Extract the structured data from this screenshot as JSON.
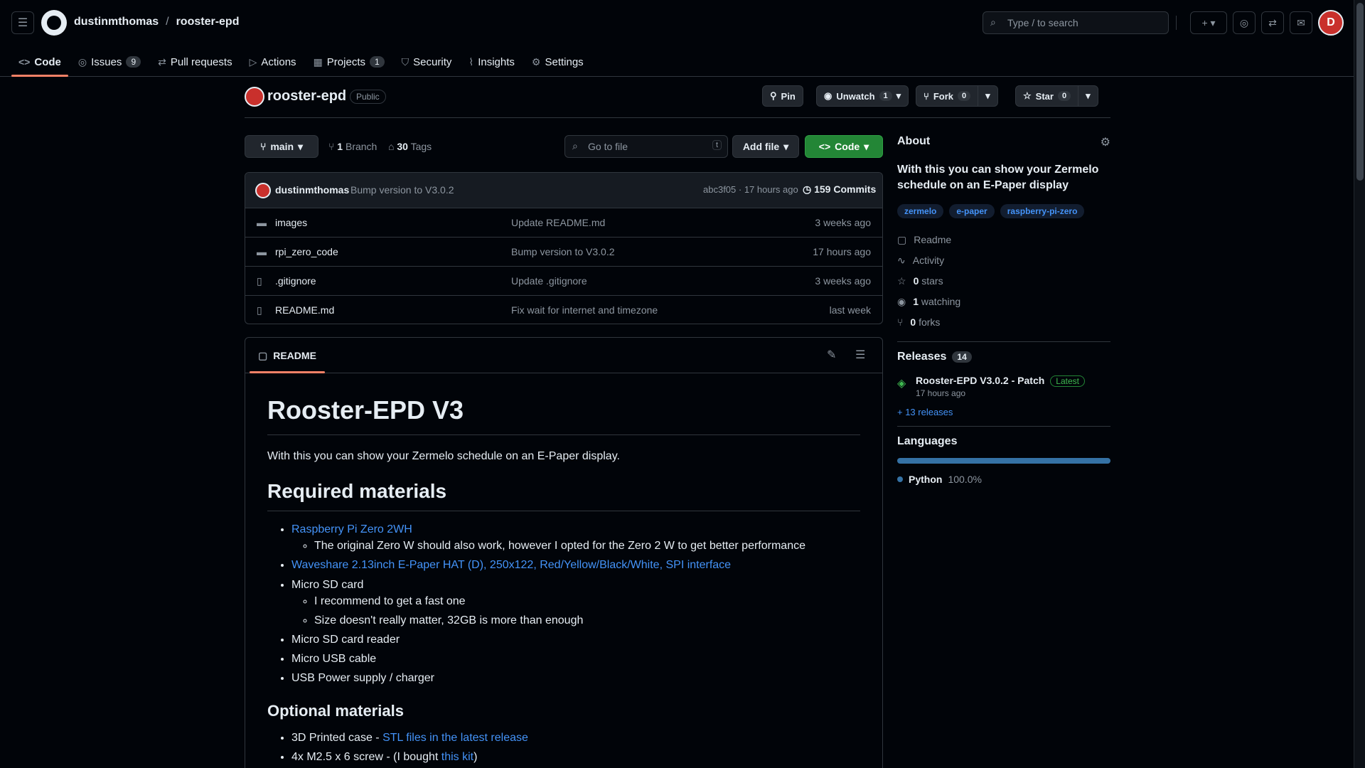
{
  "header": {
    "owner": "dustinmthomas",
    "separator": "/",
    "repo": "rooster-epd",
    "search_placeholder": "Type / to search",
    "avatar_initial": "D",
    "plus_label": "+"
  },
  "repo_nav": [
    {
      "label": "Code",
      "icon": "<>",
      "count": ""
    },
    {
      "label": "Issues",
      "icon": "◎",
      "count": "9"
    },
    {
      "label": "Pull requests",
      "icon": "⇄",
      "count": ""
    },
    {
      "label": "Actions",
      "icon": "▷",
      "count": ""
    },
    {
      "label": "Projects",
      "icon": "▦",
      "count": "1"
    },
    {
      "label": "Security",
      "icon": "⛉",
      "count": ""
    },
    {
      "label": "Insights",
      "icon": "⌇",
      "count": ""
    },
    {
      "label": "Settings",
      "icon": "⚙",
      "count": ""
    }
  ],
  "repo_head": {
    "name": "rooster-epd",
    "visibility": "Public",
    "pin_label": "Pin",
    "unwatch_label": "Unwatch",
    "unwatch_count": "1",
    "fork_label": "Fork",
    "fork_count": "0",
    "star_label": "Star",
    "star_count": "0"
  },
  "branch_bar": {
    "branch": "main",
    "branches_count": "1",
    "branches_label": "Branch",
    "tags_count": "30",
    "tags_label": "Tags",
    "goto_placeholder": "Go to file",
    "goto_kbd": "t",
    "add_file_label": "Add file",
    "code_label": "Code"
  },
  "latest_commit": {
    "author": "dustinmthomas",
    "message": "Bump version to V3.0.2",
    "hash_time": "abc3f05 · 17 hours ago",
    "commits": "159 Commits"
  },
  "files": [
    {
      "type": "dir",
      "name": "images",
      "message": "Update README.md",
      "date": "3 weeks ago"
    },
    {
      "type": "dir",
      "name": "rpi_zero_code",
      "message": "Bump version to V3.0.2",
      "date": "17 hours ago"
    },
    {
      "type": "file",
      "name": ".gitignore",
      "message": "Update .gitignore",
      "date": "3 weeks ago"
    },
    {
      "type": "file",
      "name": "README.md",
      "message": "Fix wait for internet and timezone",
      "date": "last week"
    }
  ],
  "readme": {
    "tab_label": "README",
    "title": "Rooster-EPD V3",
    "intro": "With this you can show your Zermelo schedule on an E-Paper display.",
    "h_required": "Required materials",
    "item1_link": "Raspberry Pi Zero 2WH",
    "item1_sub": "The original Zero W should also work, however I opted for the Zero 2 W to get better performance",
    "item2_link": "Waveshare 2.13inch E-Paper HAT (D), 250x122, Red/Yellow/Black/White, SPI interface",
    "item3": "Micro SD card",
    "item3_sub1": "I recommend to get a fast one",
    "item3_sub2": "Size doesn't really matter, 32GB is more than enough",
    "item4": "Micro SD card reader",
    "item5": "Micro USB cable",
    "item6": "USB Power supply / charger",
    "h_optional": "Optional materials",
    "opt1_text": "3D Printed case - ",
    "opt1_link": "STL files in the latest release",
    "opt2_text": "4x M2.5 x 6 screw - (I bought ",
    "opt2_link": "this kit",
    "opt2_end": ")"
  },
  "about": {
    "title": "About",
    "description": "With this you can show your Zermelo schedule on an E-Paper display",
    "topics": [
      "zermelo",
      "e-paper",
      "raspberry-pi-zero"
    ],
    "links": [
      {
        "icon": "▢",
        "label": "Readme",
        "count": ""
      },
      {
        "icon": "∿",
        "label": "Activity",
        "count": ""
      },
      {
        "icon": "☆",
        "label": "stars",
        "count": "0"
      },
      {
        "icon": "◉",
        "label": "watching",
        "count": "1"
      },
      {
        "icon": "⑂",
        "label": "forks",
        "count": "0"
      }
    ]
  },
  "releases": {
    "title": "Releases",
    "count": "14",
    "latest_name": "Rooster-EPD V3.0.2 - Patch",
    "latest_badge": "Latest",
    "latest_date": "17 hours ago",
    "more": "+ 13 releases"
  },
  "languages": {
    "title": "Languages",
    "items": [
      {
        "name": "Python",
        "percent": "100.0%",
        "color": "#3572a5"
      }
    ]
  },
  "colors": {
    "bg": "#010409",
    "border": "#30363d",
    "accent_tab": "#f78166",
    "link": "#4493f8",
    "code_button": "#238636"
  }
}
